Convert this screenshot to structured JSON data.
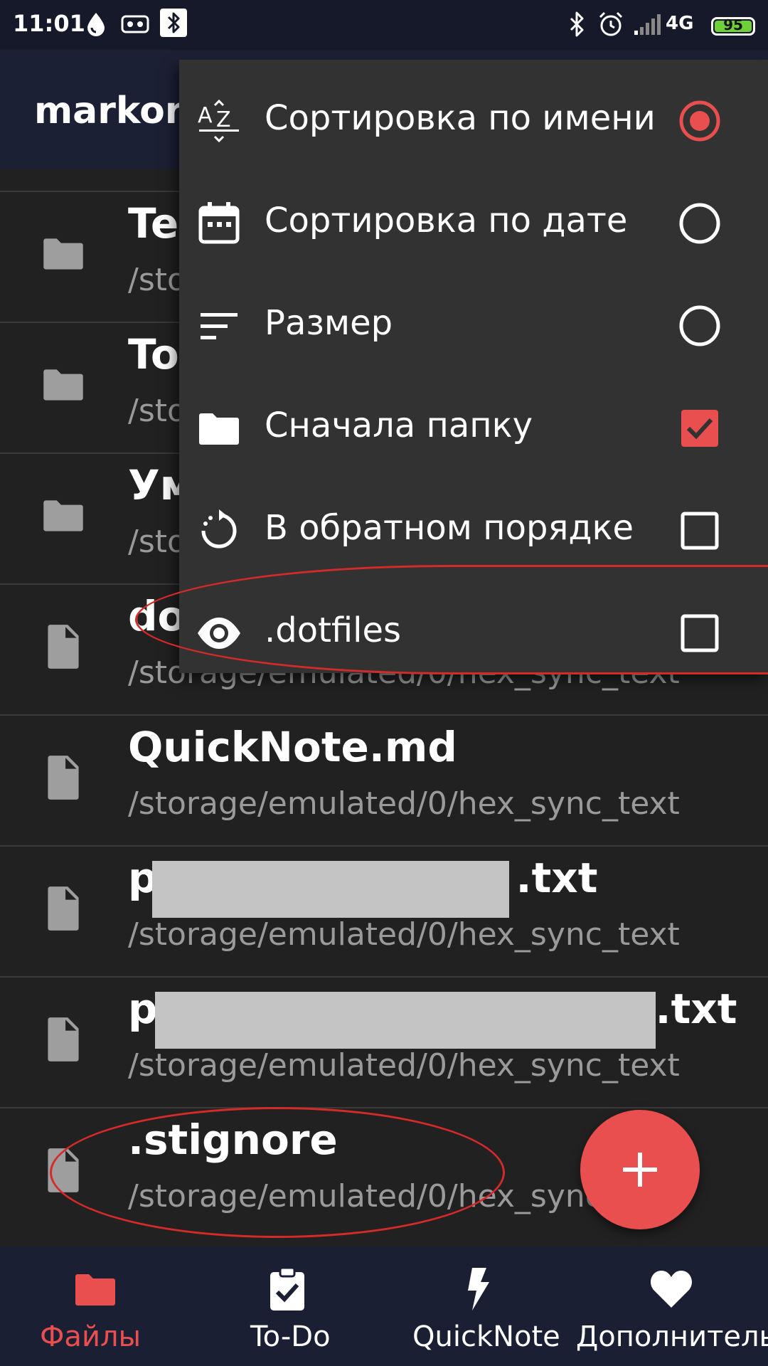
{
  "status_bar": {
    "time": "11:01",
    "network": "4G",
    "battery": "95"
  },
  "app_bar": {
    "title": "markor"
  },
  "files": [
    {
      "name": "Te",
      "path": "/sto",
      "kind": "folder"
    },
    {
      "name": "To",
      "path": "/sto",
      "kind": "folder"
    },
    {
      "name": "Ум",
      "path": "/sto",
      "kind": "folder"
    },
    {
      "name": "do",
      "path": "/storage/emulated/0/hex_sync_text",
      "kind": "file"
    },
    {
      "name": "QuickNote.md",
      "path": "/storage/emulated/0/hex_sync_text",
      "kind": "file"
    },
    {
      "name_prefix": "p",
      "name_suffix": ".txt",
      "path": "/storage/emulated/0/hex_sync_text",
      "kind": "file"
    },
    {
      "name_prefix": "p",
      "name_suffix": ".txt",
      "path": "/storage/emulated/0/hex_sync_text",
      "kind": "file"
    },
    {
      "name": ".stignore",
      "path": "/storage/emulated/0/hex_sync_text",
      "kind": "file"
    }
  ],
  "menu": {
    "items": [
      {
        "label": "Сортировка по имени",
        "icon": "sort-alpha-icon",
        "control": "radio",
        "checked": true
      },
      {
        "label": "Сортировка по дате",
        "icon": "calendar-icon",
        "control": "radio",
        "checked": false
      },
      {
        "label": "Размер",
        "icon": "sort-lines-icon",
        "control": "radio",
        "checked": false
      },
      {
        "label": "Сначала папку",
        "icon": "folder-icon",
        "control": "checkbox",
        "checked": true
      },
      {
        "label": "В обратном порядке",
        "icon": "rotate-icon",
        "control": "checkbox",
        "checked": false
      },
      {
        "label": ".dotfiles",
        "icon": "eye-icon",
        "control": "checkbox",
        "checked": false
      }
    ]
  },
  "fab": {
    "icon": "plus-icon"
  },
  "bottom_nav": {
    "items": [
      {
        "label": "Файлы",
        "icon": "folder-icon",
        "active": true
      },
      {
        "label": "To-Do",
        "icon": "clipboard-check-icon",
        "active": false
      },
      {
        "label": "QuickNote",
        "icon": "lightning-icon",
        "active": false
      },
      {
        "label": "Дополнитель",
        "icon": "heart-icon",
        "active": false
      }
    ]
  },
  "colors": {
    "accent": "#e94f4f",
    "background": "#212121",
    "bar": "#1c2034",
    "menu": "#323232",
    "annotation": "#d42a2a"
  }
}
